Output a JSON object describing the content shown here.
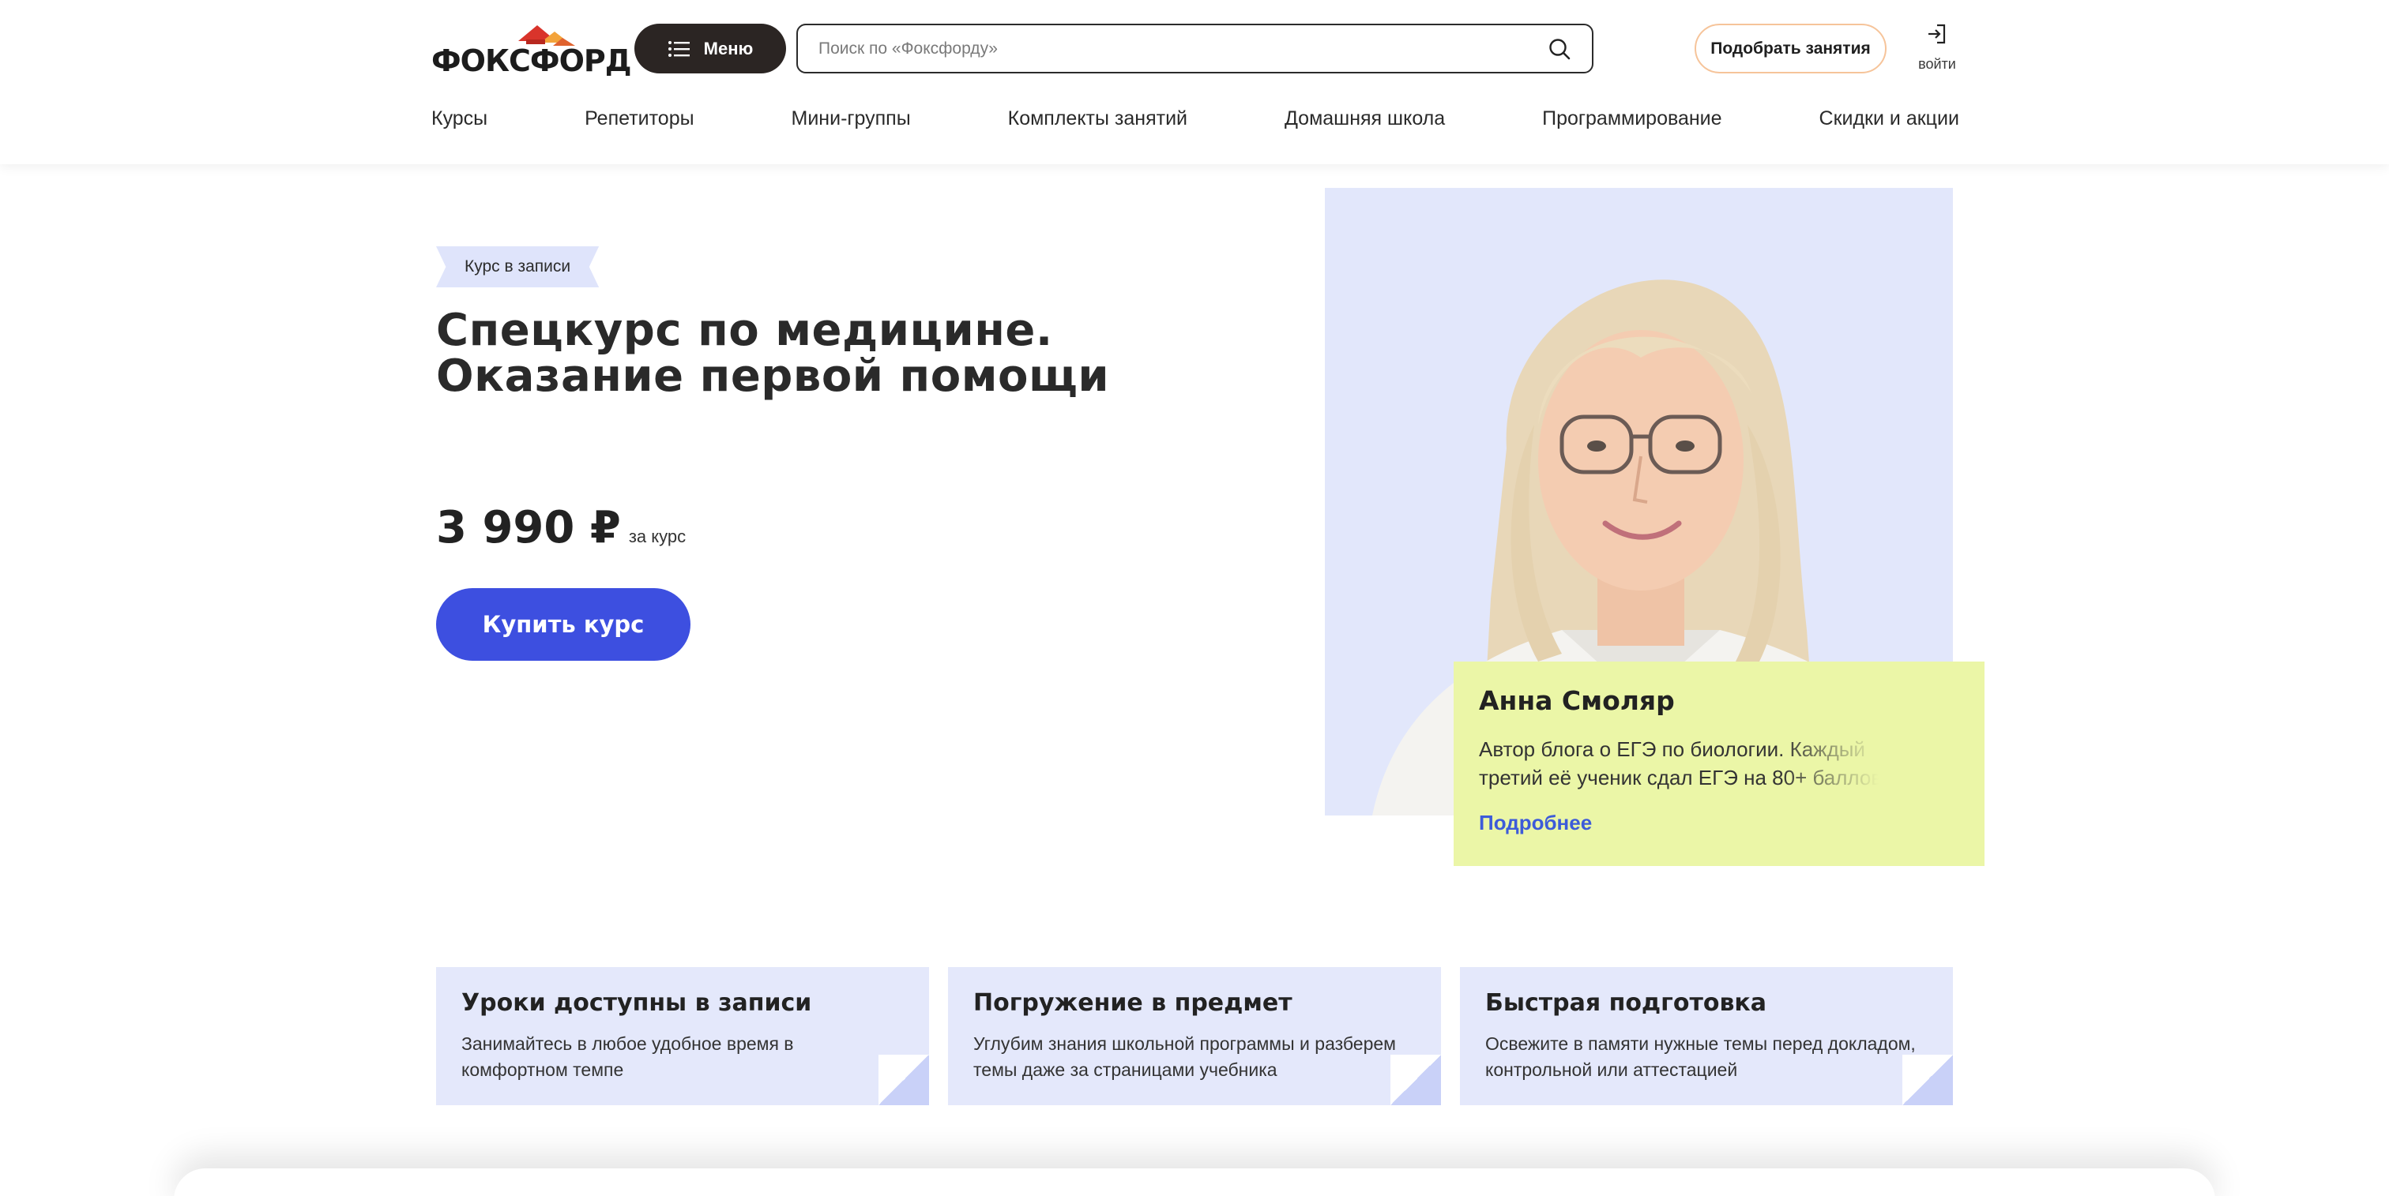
{
  "header": {
    "logo_text": "ФОКСФОРД",
    "menu_label": "Меню",
    "search_placeholder": "Поиск по «Фоксфорду»",
    "pick_label": "Подобрать занятия",
    "login_label": "войти"
  },
  "nav": {
    "items": [
      {
        "label": "Курсы"
      },
      {
        "label": "Репетиторы"
      },
      {
        "label": "Мини-группы"
      },
      {
        "label": "Комплекты занятий"
      },
      {
        "label": "Домашняя школа"
      },
      {
        "label": "Программирование"
      },
      {
        "label": "Скидки и акции"
      }
    ]
  },
  "hero": {
    "tag": "Курс в записи",
    "title_line1": "Спецкурс по медицине.",
    "title_line2": "Оказание первой помощи",
    "price": "3 990 ₽",
    "price_unit": "за курс",
    "buy_label": "Купить курс"
  },
  "teacher": {
    "name": "Анна Смоляр",
    "bio": "Автор блога о ЕГЭ по биологии. Каждый третий её ученик сдал ЕГЭ на 80+ баллов",
    "more_label": "Подробнее"
  },
  "features": [
    {
      "title": "Уроки доступны в записи",
      "text": "Занимайтесь в любое удобное время в комфортном темпе"
    },
    {
      "title": "Погружение в предмет",
      "text": "Углубим знания школьной программы и разберем темы даже за страницами учебника"
    },
    {
      "title": "Быстрая подготовка",
      "text": "Освежите в памяти нужные темы перед докладом, контрольной или аттестацией"
    }
  ],
  "colors": {
    "accent": "#3d4fe0",
    "dark": "#2b2523",
    "card_yellow": "#ebf6a7",
    "card_blue": "#e4e8fb",
    "link_blue": "#3d5bd9"
  }
}
